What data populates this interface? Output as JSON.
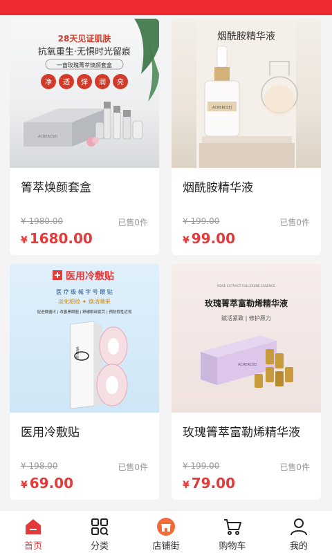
{
  "products": [
    {
      "name": "箐萃焕颜套盒",
      "original_price": "¥ 1980.00",
      "sold": "已售0件",
      "currency": "¥",
      "price": "1680.00",
      "image": {
        "headline": "28天见证肌肤",
        "subline": "抗氧重生·无惧时光留痕",
        "banner": "一亩玫瑰菁萃焕颜套盒",
        "badges": [
          "净",
          "透",
          "弹",
          "润",
          "亮"
        ],
        "brand": "ACRERCSEI"
      }
    },
    {
      "name": "烟酰胺精华液",
      "original_price": "¥ 199.00",
      "sold": "已售0件",
      "currency": "¥",
      "price": "99.00",
      "image": {
        "headline": "烟酰胺精华液",
        "brand": "ACRERCSEI"
      }
    },
    {
      "name": "医用冷敷贴",
      "original_price": "¥ 198.00",
      "sold": "已售0件",
      "currency": "¥",
      "price": "69.00",
      "image": {
        "headline": "医用冷敷贴",
        "line1": "医 疗 级 械 字 号 眼 贴",
        "line2": "淡化细纹 ✦ 焕活睛采",
        "line3": "促进微循环 | 改善黑眼圈 | 舒缓眼部疲劳 | 预防假性近视",
        "brand": "YANHUI"
      }
    },
    {
      "name": "玫瑰箐萃富勒烯精华液",
      "original_price": "¥ 199.00",
      "sold": "已售0件",
      "currency": "¥",
      "price": "79.00",
      "image": {
        "english": "ROSE EXTRACT FULLERENE ESSENCE",
        "headline": "玫瑰菁萃富勒烯精华液",
        "subline": "赋活紧致 | 修护原力",
        "brand": "ACRERCSEI"
      }
    }
  ],
  "tabbar": {
    "items": [
      {
        "label": "首页",
        "icon": "home-icon",
        "active": true
      },
      {
        "label": "分类",
        "icon": "category-icon"
      },
      {
        "label": "店铺街",
        "icon": "store-icon"
      },
      {
        "label": "购物车",
        "icon": "cart-icon"
      },
      {
        "label": "我的",
        "icon": "user-icon"
      }
    ],
    "active_color": "#e53a3a"
  },
  "colors": {
    "brand_red": "#ee2b32",
    "price_red": "#e53a3a",
    "background": "#f4f4f4"
  }
}
